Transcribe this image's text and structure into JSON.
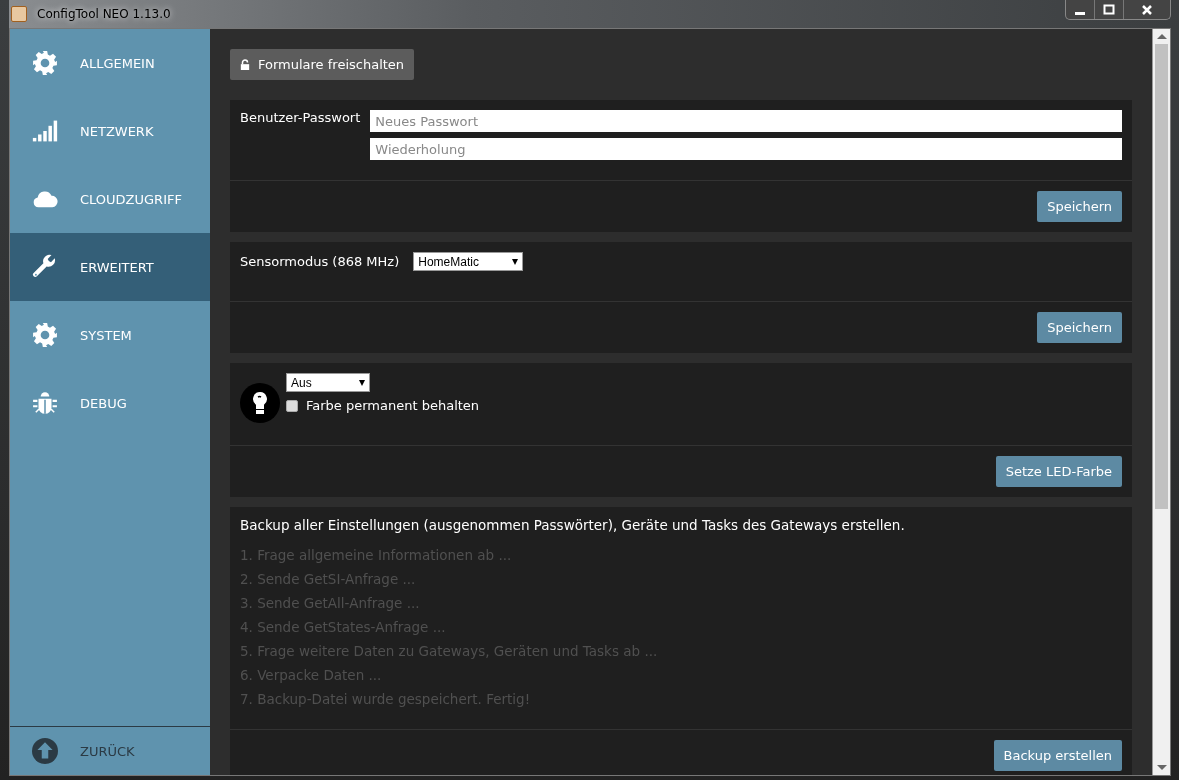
{
  "window": {
    "title": "ConfigTool NEO 1.13.0"
  },
  "sidebar": {
    "items": [
      {
        "label": "ALLGEMEIN",
        "selected": false
      },
      {
        "label": "NETZWERK",
        "selected": false
      },
      {
        "label": "CLOUDZUGRIFF",
        "selected": false
      },
      {
        "label": "ERWEITERT",
        "selected": true
      },
      {
        "label": "SYSTEM",
        "selected": false
      },
      {
        "label": "DEBUG",
        "selected": false
      }
    ],
    "back": {
      "label": "ZURÜCK"
    }
  },
  "unlock_button": {
    "label": "Formulare freischalten"
  },
  "password_panel": {
    "label": "Benutzer-Passwort",
    "fields": [
      {
        "placeholder": "Neues Passwort"
      },
      {
        "placeholder": "Wiederholung"
      }
    ],
    "button": "Speichern"
  },
  "sensor_panel": {
    "label": "Sensormodus (868 MHz)",
    "select": "HomeMatic",
    "button": "Speichern"
  },
  "led_panel": {
    "select": "Aus",
    "checkbox": {
      "label": "Farbe permanent behalten",
      "checked": false
    },
    "button": "Setze LED-Farbe"
  },
  "backup_panel": {
    "description": "Backup aller Einstellungen (ausgenommen Passwörter), Geräte und Tasks des Gateways erstellen.",
    "steps": [
      "1. Frage allgemeine Informationen ab ...",
      "2. Sende GetSI-Anfrage ...",
      "3. Sende GetAll-Anfrage ...",
      "4. Sende GetStates-Anfrage ...",
      "5. Frage weitere Daten zu Gateways, Geräten und Tasks ab ...",
      "6. Verpacke Daten ...",
      "7. Backup-Datei wurde gespeichert. Fertig!"
    ],
    "button": "Backup erstellen"
  }
}
